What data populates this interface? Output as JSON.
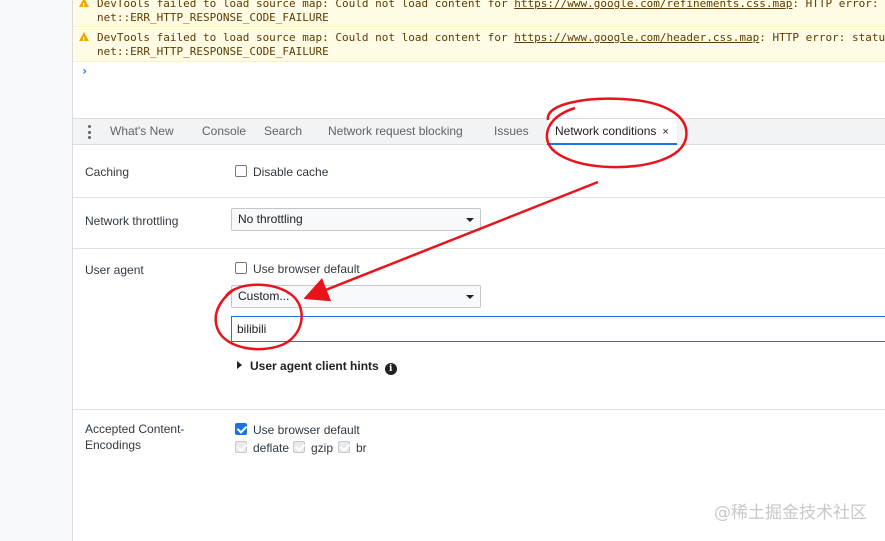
{
  "console": {
    "warnings": [
      {
        "prefix": "DevTools failed to load source map: Could not load content for ",
        "url": "https://www.google.com/refinements.css.map",
        "suffix": ": HTTP error: s",
        "line2": "net::ERR_HTTP_RESPONSE_CODE_FAILURE"
      },
      {
        "prefix": "DevTools failed to load source map: Could not load content for ",
        "url": "https://www.google.com/header.css.map",
        "suffix": ": HTTP error: status",
        "line2": "net::ERR_HTTP_RESPONSE_CODE_FAILURE"
      }
    ],
    "prompt": "›"
  },
  "drawer": {
    "tabs": [
      {
        "label": "What's New"
      },
      {
        "label": "Console"
      },
      {
        "label": "Search"
      },
      {
        "label": "Network request blocking"
      },
      {
        "label": "Issues"
      },
      {
        "label": "Network conditions",
        "close": "×"
      }
    ]
  },
  "network_conditions": {
    "caching": {
      "label": "Caching",
      "checkbox_label": "Disable cache",
      "checked": false
    },
    "throttling": {
      "label": "Network throttling",
      "selected": "No throttling"
    },
    "user_agent": {
      "label": "User agent",
      "use_default_label": "Use browser default",
      "use_default_checked": false,
      "selected": "Custom...",
      "value": "bilibili",
      "client_hints_label": "User agent client hints",
      "info_glyph": "i"
    },
    "encodings": {
      "label_line1": "Accepted Content-",
      "label_line2": "Encodings",
      "use_default_label": "Use browser default",
      "use_default_checked": true,
      "options": [
        {
          "label": "deflate",
          "checked": true
        },
        {
          "label": "gzip",
          "checked": true
        },
        {
          "label": "br",
          "checked": true
        }
      ]
    }
  },
  "annotation": {
    "color": "#e8141c"
  },
  "watermark": "@稀土掘金技术社区"
}
